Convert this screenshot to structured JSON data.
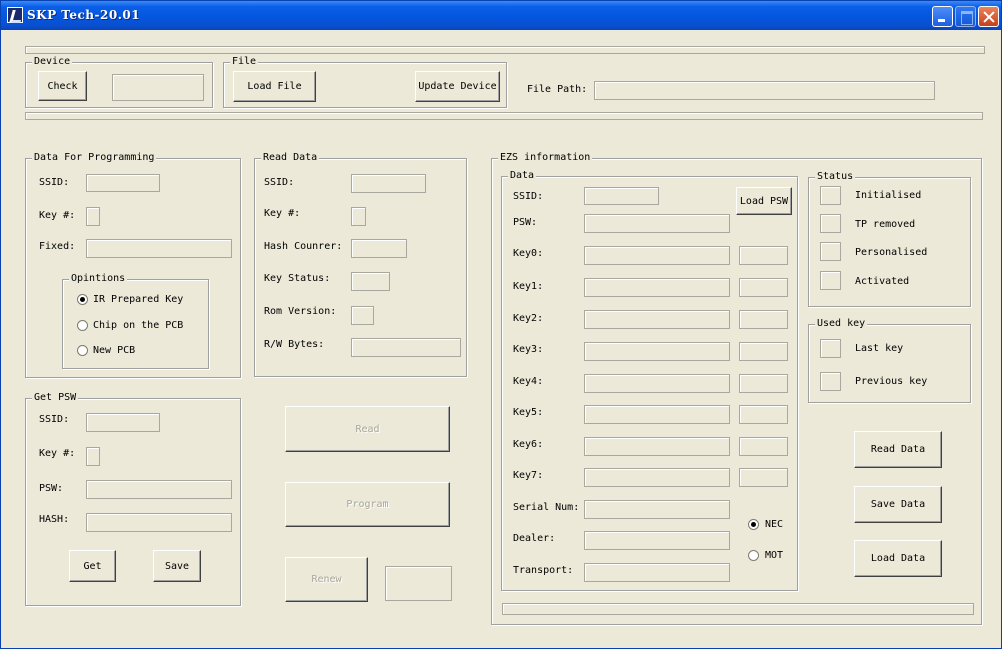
{
  "window": {
    "title": "SKP Tech-20.01"
  },
  "device": {
    "legend": "Device",
    "check_label": "Check"
  },
  "file": {
    "legend": "File",
    "load_label": "Load File",
    "update_label": "Update Device",
    "path_label": "File Path:"
  },
  "programming": {
    "legend": "Data For Programming",
    "ssid_label": "SSID:",
    "key_label": "Key #:",
    "fixed_label": "Fixed:",
    "options_legend": "Opintions",
    "options": [
      "IR Prepared Key",
      "Chip on the PCB",
      "New PCB"
    ],
    "selected_option": "IR Prepared Key"
  },
  "read_data": {
    "legend": "Read Data",
    "ssid_label": "SSID:",
    "key_label": "Key #:",
    "hash_label": "Hash Counrer:",
    "status_label": "Key Status:",
    "rom_label": "Rom Version:",
    "rw_label": "R/W Bytes:"
  },
  "get_psw": {
    "legend": "Get PSW",
    "ssid_label": "SSID:",
    "key_label": "Key #:",
    "psw_label": "PSW:",
    "hash_label": "HASH:",
    "get_label": "Get",
    "save_label": "Save"
  },
  "actions": {
    "read_label": "Read",
    "program_label": "Program",
    "renew_label": "Renew"
  },
  "ezs": {
    "legend": "EZS information",
    "data_legend": "Data",
    "ssid_label": "SSID:",
    "psw_label": "PSW:",
    "load_psw_label": "Load PSW",
    "keys": [
      "Key0:",
      "Key1:",
      "Key2:",
      "Key3:",
      "Key4:",
      "Key5:",
      "Key6:",
      "Key7:"
    ],
    "serial_label": "Serial Num:",
    "dealer_label": "Dealer:",
    "transport_label": "Transport:",
    "nec_label": "NEC",
    "mot_label": "MOT",
    "selected_radio": "NEC",
    "status_legend": "Status",
    "status": [
      "Initialised",
      "TP removed",
      "Personalised",
      "Activated"
    ],
    "used_key_legend": "Used key",
    "used_keys": [
      "Last key",
      "Previous key"
    ],
    "read_data_label": "Read Data",
    "save_data_label": "Save Data",
    "load_data_label": "Load Data"
  }
}
